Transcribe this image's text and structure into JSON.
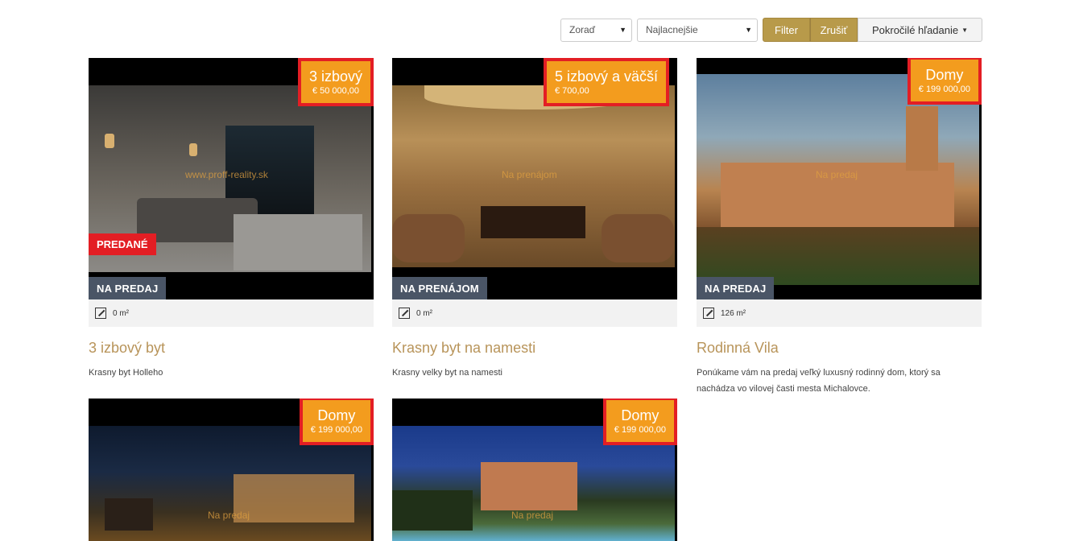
{
  "toolbar": {
    "order_label": "Zoraď",
    "sort_label": "Najlacnejšie",
    "filter_label": "Filter",
    "cancel_label": "Zrušiť",
    "advanced_label": "Pokročilé hľadanie"
  },
  "listings": [
    {
      "type": "3 izbový",
      "price": "€ 50 000,00",
      "watermark": "www.proff-reality.sk",
      "sold_label": "PREDANÉ",
      "status": "NA PREDAJ",
      "area": "0 m²",
      "title": "3 izbový byt",
      "description": "Krasny byt Holleho"
    },
    {
      "type": "5 izbový a väčší",
      "price": "€ 700,00",
      "watermark": "Na prenájom",
      "status": "NA PRENÁJOM",
      "area": "0 m²",
      "title": "Krasny byt na namesti",
      "description": "Krasny velky byt na namesti"
    },
    {
      "type": "Domy",
      "price": "€ 199 000,00",
      "watermark": "Na predaj",
      "status": "NA PREDAJ",
      "area": "126 m²",
      "title": "Rodinná Vila",
      "description": "Ponúkame vám na predaj veľký luxusný rodinný dom, ktorý sa nachádza vo vilovej časti mesta Michalovce."
    },
    {
      "type": "Domy",
      "price": "€ 199 000,00",
      "watermark": "Na predaj"
    },
    {
      "type": "Domy",
      "price": "€ 199 000,00",
      "watermark": "Na predaj"
    }
  ],
  "colors": {
    "accent": "#b89a4a",
    "price_bg": "#f39c1e",
    "highlight": "#e31e24",
    "status_bg": "#4a5566",
    "title": "#b8945a"
  }
}
